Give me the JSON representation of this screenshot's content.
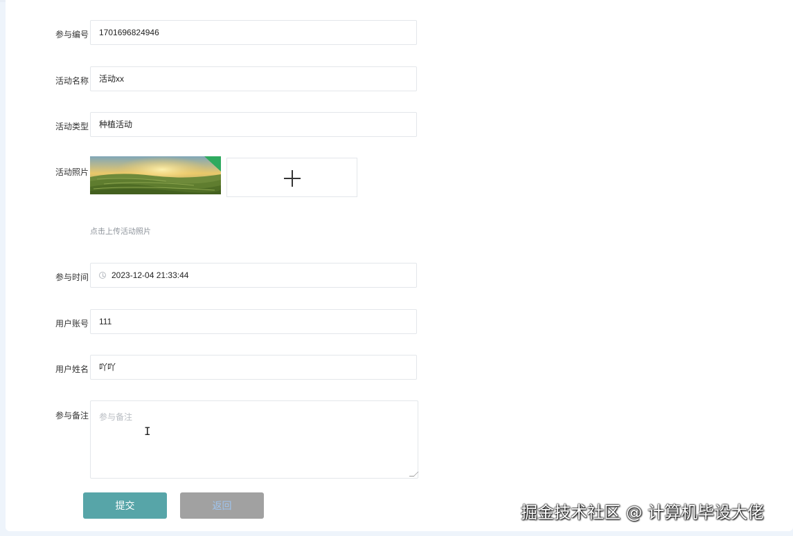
{
  "form": {
    "participation_no": {
      "label": "参与编号",
      "value": "1701696824946"
    },
    "activity_name": {
      "label": "活动名称",
      "value": "活动xx"
    },
    "activity_type": {
      "label": "活动类型",
      "value": "种植活动"
    },
    "activity_photo": {
      "label": "活动照片",
      "upload_icon": "plus-icon",
      "hint": "点击上传活动照片"
    },
    "participation_time": {
      "label": "参与时间",
      "icon": "clock-icon",
      "value": "2023-12-04 21:33:44"
    },
    "user_account": {
      "label": "用户账号",
      "value": "111"
    },
    "user_name": {
      "label": "用户姓名",
      "value": "吖吖"
    },
    "remarks": {
      "label": "参与备注",
      "placeholder": "参与备注",
      "value": ""
    }
  },
  "buttons": {
    "submit_label": "提交",
    "back_label": "返回"
  },
  "watermark": "掘金技术社区 @ 计算机毕设大佬",
  "colors": {
    "submit_bg": "#57a5a8",
    "back_bg": "#a1a1a1"
  }
}
